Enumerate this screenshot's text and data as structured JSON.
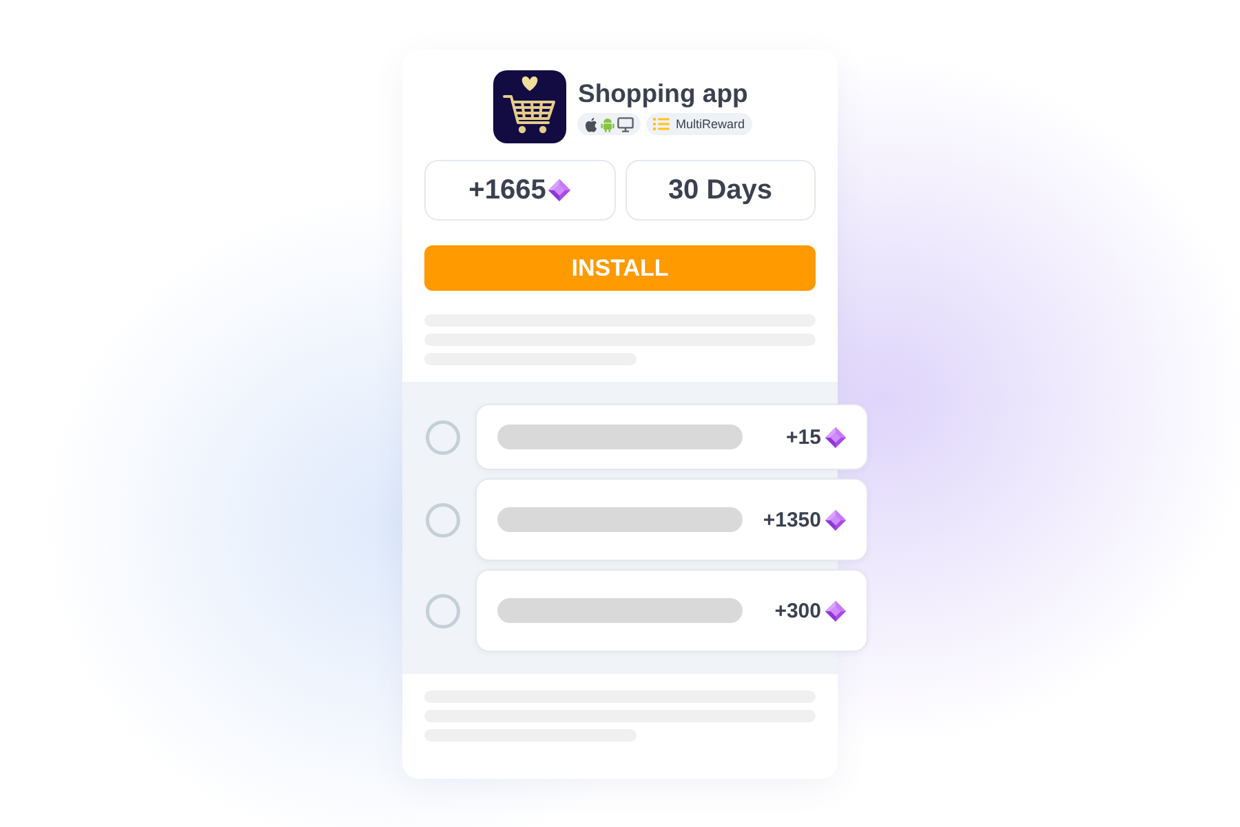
{
  "app": {
    "title": "Shopping app",
    "badge": {
      "label": "MultiReward"
    }
  },
  "stats": [
    {
      "kind": "reward",
      "value": "+1665"
    },
    {
      "kind": "duration",
      "value": "30 Days"
    }
  ],
  "install_button": {
    "label": "INSTALL"
  },
  "tasks": [
    {
      "reward": "+15",
      "checked": false
    },
    {
      "reward": "+1350",
      "checked": false
    },
    {
      "reward": "+300",
      "checked": false
    }
  ]
}
